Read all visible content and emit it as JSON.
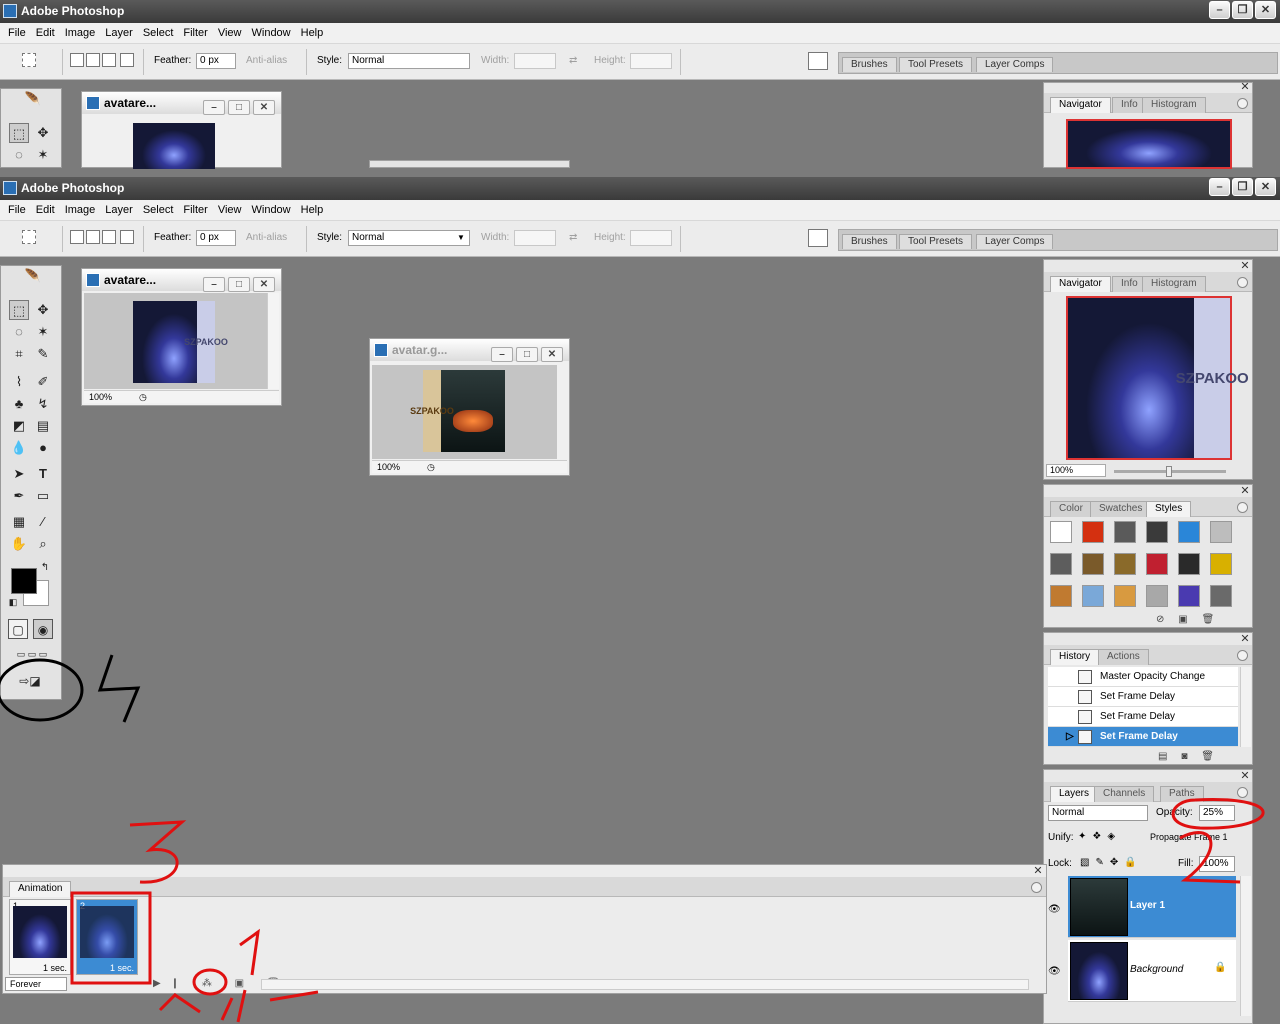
{
  "app": {
    "title": "Adobe Photoshop"
  },
  "menus": [
    "File",
    "Edit",
    "Image",
    "Layer",
    "Select",
    "Filter",
    "View",
    "Window",
    "Help"
  ],
  "options": {
    "feather_label": "Feather:",
    "feather_value": "0 px",
    "antialias_label": "Anti-alias",
    "style_label": "Style:",
    "style_value": "Normal",
    "width_label": "Width:",
    "height_label": "Height:"
  },
  "palette_well": {
    "tabs": [
      "Brushes",
      "Tool Presets",
      "Layer Comps"
    ]
  },
  "doc1": {
    "title": "avatare...",
    "zoom": "100%",
    "side_text": "SZPAKOO"
  },
  "doc2": {
    "title": "avatar.g...",
    "zoom": "100%",
    "side_text": "SZPAKOO"
  },
  "navigator": {
    "tabs": [
      "Navigator",
      "Info",
      "Histogram"
    ],
    "zoom": "100%",
    "side_text": "SZPAKOO"
  },
  "styles_panel": {
    "tabs": [
      "Color",
      "Swatches",
      "Styles"
    ]
  },
  "history": {
    "tabs": [
      "History",
      "Actions"
    ],
    "items": [
      "Master Opacity Change",
      "Set Frame Delay",
      "Set Frame Delay",
      "Set Frame Delay"
    ]
  },
  "layers": {
    "tabs": [
      "Layers",
      "Channels",
      "Paths"
    ],
    "blend_mode": "Normal",
    "opacity_label": "Opacity:",
    "opacity_value": "25%",
    "unify_label": "Unify:",
    "propagate_label": "Propagate Frame 1",
    "lock_label": "Lock:",
    "fill_label": "Fill:",
    "fill_value": "100%",
    "rows": [
      {
        "name": "Layer 1",
        "selected": true
      },
      {
        "name": "Background",
        "selected": false
      }
    ]
  },
  "animation": {
    "tab": "Animation",
    "frames": [
      {
        "num": "1",
        "delay": "1 sec.",
        "selected": false
      },
      {
        "num": "2",
        "delay": "1 sec.",
        "selected": true
      }
    ],
    "loop": "Forever"
  },
  "annotations": [
    "1",
    "2",
    "3",
    "4",
    "5"
  ],
  "colors": {
    "selection": "#3c8bd3",
    "annotation_red": "#e01010",
    "annotation_black": "#000000"
  }
}
